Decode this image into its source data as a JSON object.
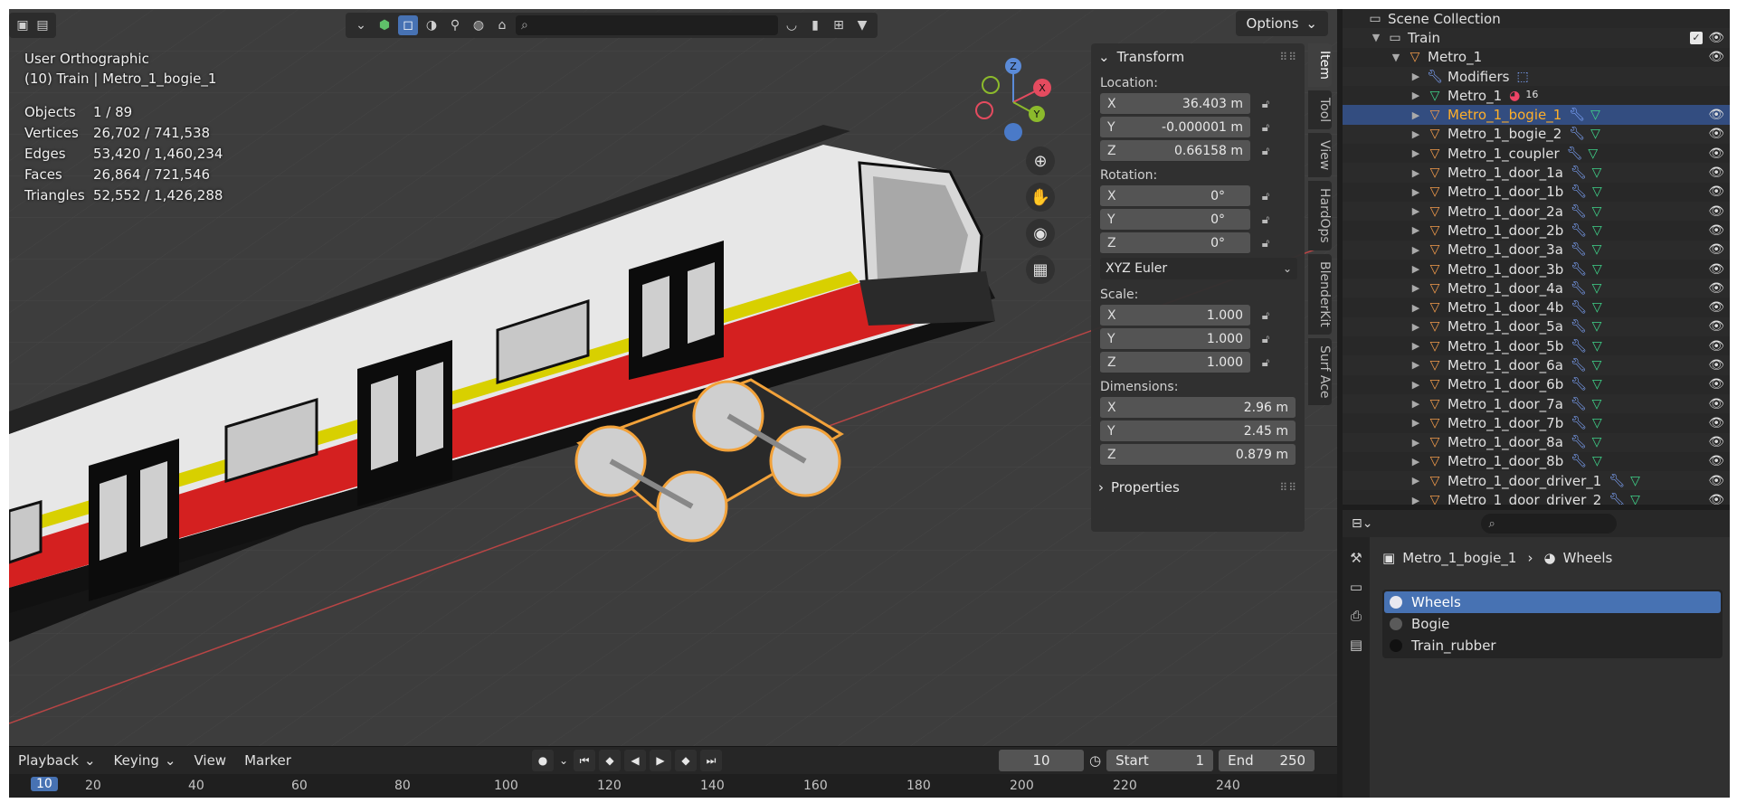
{
  "viewport": {
    "view_name": "User Orthographic",
    "context": "(10) Train | Metro_1_bogie_1",
    "stats": [
      {
        "label": "Objects",
        "value": "1 / 89"
      },
      {
        "label": "Vertices",
        "value": "26,702 / 741,538"
      },
      {
        "label": "Edges",
        "value": "53,420 / 1,460,234"
      },
      {
        "label": "Faces",
        "value": "26,864 / 721,546"
      },
      {
        "label": "Triangles",
        "value": "52,552 / 1,426,288"
      }
    ],
    "options_label": "Options",
    "gizmo": {
      "x": "X",
      "y": "Y",
      "z": "Z"
    }
  },
  "npanel": {
    "transform_title": "Transform",
    "location_label": "Location:",
    "location": [
      {
        "axis": "X",
        "value": "36.403 m"
      },
      {
        "axis": "Y",
        "value": "-0.000001 m"
      },
      {
        "axis": "Z",
        "value": "0.66158 m"
      }
    ],
    "rotation_label": "Rotation:",
    "rotation": [
      {
        "axis": "X",
        "value": "0°"
      },
      {
        "axis": "Y",
        "value": "0°"
      },
      {
        "axis": "Z",
        "value": "0°"
      }
    ],
    "rotation_mode": "XYZ Euler",
    "scale_label": "Scale:",
    "scale": [
      {
        "axis": "X",
        "value": "1.000"
      },
      {
        "axis": "Y",
        "value": "1.000"
      },
      {
        "axis": "Z",
        "value": "1.000"
      }
    ],
    "dimensions_label": "Dimensions:",
    "dimensions": [
      {
        "axis": "X",
        "value": "2.96 m"
      },
      {
        "axis": "Y",
        "value": "2.45 m"
      },
      {
        "axis": "Z",
        "value": "0.879 m"
      }
    ],
    "properties_title": "Properties"
  },
  "sidetabs": [
    "Item",
    "Tool",
    "View",
    "HardOps",
    "BlenderKit",
    "Surf Ace"
  ],
  "timeline": {
    "menus": [
      "Playback",
      "Keying",
      "View",
      "Marker"
    ],
    "current_frame": "10",
    "start_label": "Start",
    "start": "1",
    "end_label": "End",
    "end": "250",
    "ruler": [
      "10",
      "20",
      "40",
      "60",
      "80",
      "100",
      "120",
      "140",
      "160",
      "180",
      "200",
      "220",
      "240"
    ]
  },
  "outliner": {
    "scene_collection": "Scene Collection",
    "collection": "Train",
    "parent": "Metro_1",
    "modifiers": "Modifiers",
    "mesh": "Metro_1",
    "mesh_badge": "16",
    "children": [
      "Metro_1_bogie_1",
      "Metro_1_bogie_2",
      "Metro_1_coupler",
      "Metro_1_door_1a",
      "Metro_1_door_1b",
      "Metro_1_door_2a",
      "Metro_1_door_2b",
      "Metro_1_door_3a",
      "Metro_1_door_3b",
      "Metro_1_door_4a",
      "Metro_1_door_4b",
      "Metro_1_door_5a",
      "Metro_1_door_5b",
      "Metro_1_door_6a",
      "Metro_1_door_6b",
      "Metro_1_door_7a",
      "Metro_1_door_7b",
      "Metro_1_door_8a",
      "Metro_1_door_8b",
      "Metro_1_door_driver_1",
      "Metro_1_door_driver_2"
    ]
  },
  "properties": {
    "object_name": "Metro_1_bogie_1",
    "material_name": "Wheels",
    "materials": [
      {
        "name": "Wheels",
        "color": "#e8e8f0"
      },
      {
        "name": "Bogie",
        "color": "#5a5a5a"
      },
      {
        "name": "Train_rubber",
        "color": "#111111"
      }
    ]
  }
}
